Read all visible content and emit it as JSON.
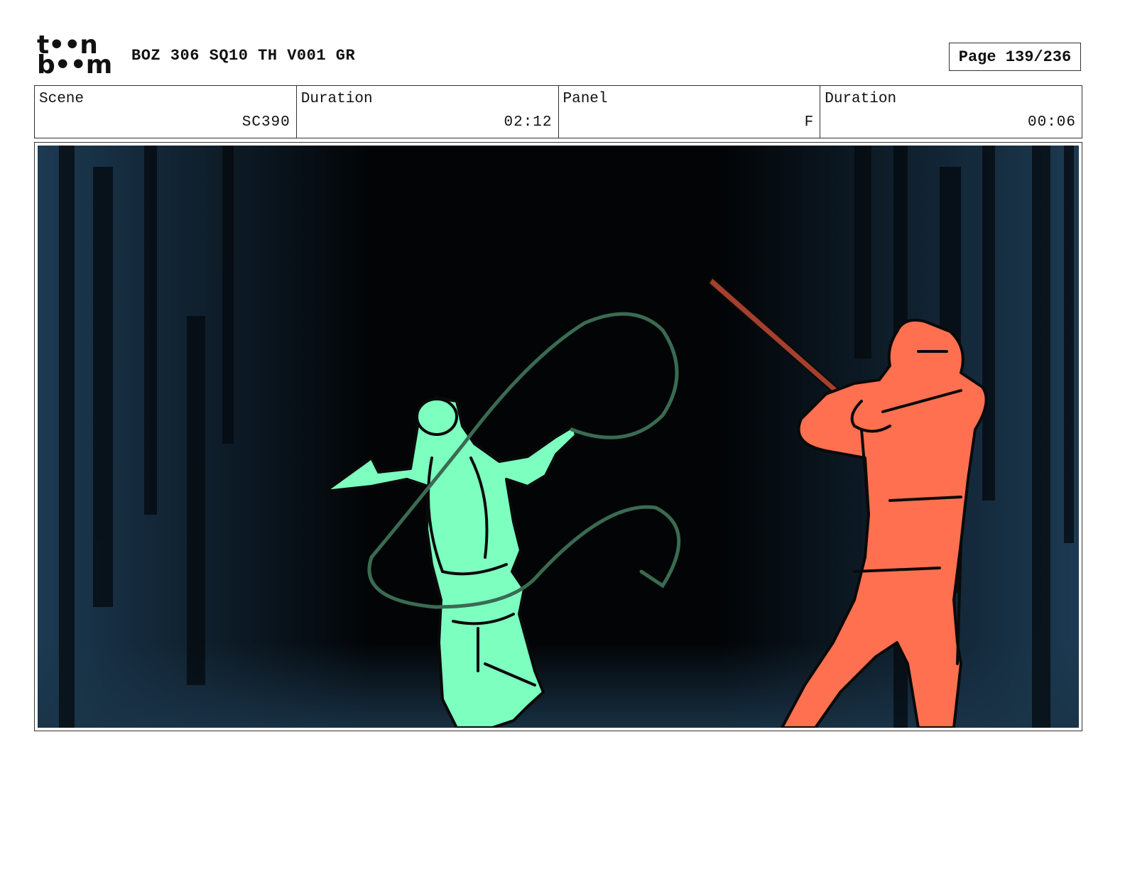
{
  "header": {
    "logo": {
      "line1": "t••n",
      "line2": "b••m",
      "text": "toon boom"
    },
    "title": "BOZ 306 SQ10 TH V001 GR",
    "page": "Page 139/236"
  },
  "info": {
    "scene_label": "Scene",
    "scene_value": "SC390",
    "duration_label": "Duration",
    "duration_value": "02:12",
    "panel_label": "Panel",
    "panel_value": "F",
    "panel_duration_label": "Duration",
    "panel_duration_value": "00:06"
  },
  "panel_image": {
    "background": "#020406",
    "side_color": "#1c3a52",
    "green_figure_fill": "#7dffc0",
    "whip_color": "#3a6b52",
    "red_figure_fill": "#ff7050",
    "sword_color": "#a5402c",
    "outline_color": "#0a0a0a"
  }
}
